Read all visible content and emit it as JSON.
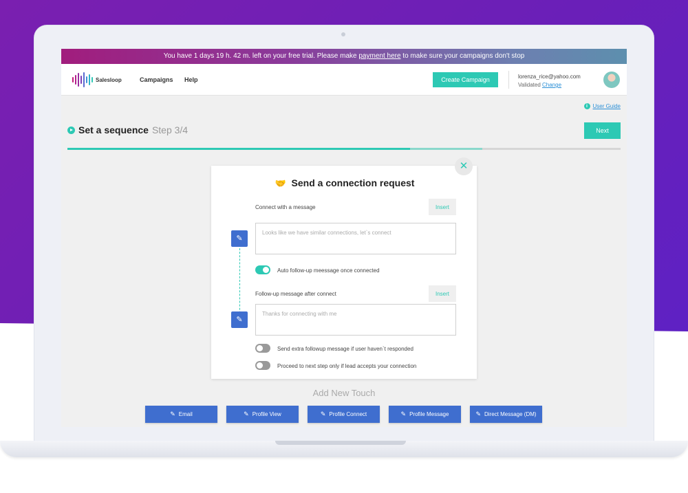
{
  "trial_banner": {
    "text_before": "You have 1 days 19 h. 42 m. left on your free trial. Please make ",
    "link": "payment here",
    "text_after": " to make sure your campaigns don't stop"
  },
  "header": {
    "logo_text": "Salesloop",
    "nav": [
      "Campaigns",
      "Help"
    ],
    "create_campaign": "Create Campaign",
    "user_email": "lorenza_rice@yahoo.com",
    "user_status": "Validated",
    "user_change": "Change"
  },
  "user_guide": "User Guide",
  "sequence": {
    "title": "Set a sequence",
    "step": "Step 3/4",
    "next": "Next",
    "progress_pct": 75,
    "progress_secondary_pct": 62
  },
  "card": {
    "title": "Send a connection request",
    "connect_label": "Connect with a message",
    "insert1": "Insert",
    "connect_placeholder": "Looks like we have similar connections, let`s connect",
    "auto_followup_label": "Auto follow-up meessage once connected",
    "followup_label": "Follow-up message after connect",
    "insert2": "Insert",
    "followup_placeholder": "Thanks for connecting with me",
    "extra_followup_label": "Send extra followup message if user haven`t responded",
    "proceed_label": "Proceed to next step only if lead accepts your connection",
    "toggles": {
      "auto_followup": true,
      "extra_followup": false,
      "proceed": false
    }
  },
  "add_touch": {
    "title": "Add New Touch",
    "buttons": [
      "Email",
      "Profile View",
      "Profile Connect",
      "Profile Message",
      "Direct Message (DM)"
    ]
  },
  "colors": {
    "accent": "#2dc9b4",
    "primary_blue": "#3f6ecf",
    "background_purple": "#6a1fb8"
  }
}
